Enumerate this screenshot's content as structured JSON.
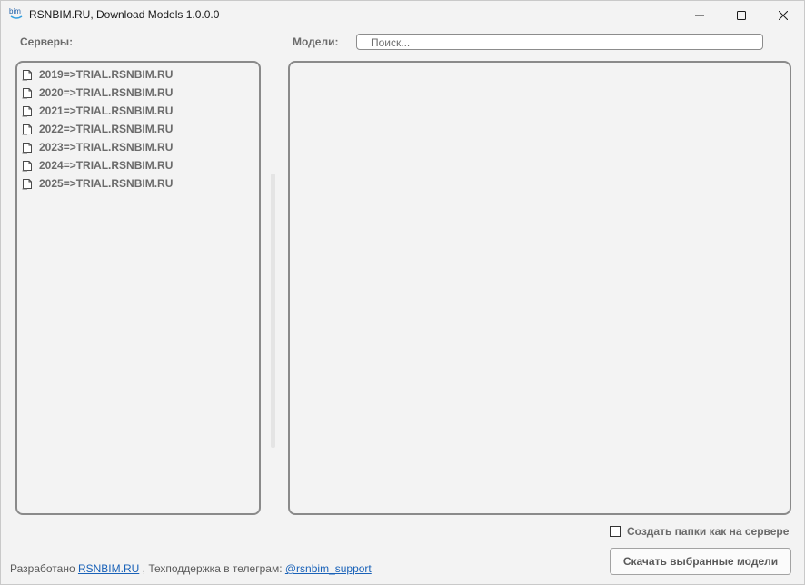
{
  "window": {
    "title": "RSNBIM.RU, Download Models 1.0.0.0",
    "app_icon_text": "bim",
    "controls": [
      "minimize-icon",
      "maximize-icon",
      "close-icon"
    ]
  },
  "servers": {
    "label": "Серверы:",
    "items": [
      {
        "label": "2019=>TRIAL.RSNBIM.RU",
        "icon": "server-file-icon"
      },
      {
        "label": "2020=>TRIAL.RSNBIM.RU",
        "icon": "server-file-icon"
      },
      {
        "label": "2021=>TRIAL.RSNBIM.RU",
        "icon": "server-file-icon"
      },
      {
        "label": "2022=>TRIAL.RSNBIM.RU",
        "icon": "server-file-icon"
      },
      {
        "label": "2023=>TRIAL.RSNBIM.RU",
        "icon": "server-file-icon"
      },
      {
        "label": "2024=>TRIAL.RSNBIM.RU",
        "icon": "server-file-icon"
      },
      {
        "label": "2025=>TRIAL.RSNBIM.RU",
        "icon": "server-file-icon"
      }
    ]
  },
  "models": {
    "label": "Модели:",
    "search_placeholder": "Поиск...",
    "items": []
  },
  "options": {
    "create_folders_label": "Создать папки как на сервере",
    "create_folders_checked": false
  },
  "footer": {
    "prefix": "Разработано",
    "dev_link": "RSNBIM.RU",
    "middle": ", Техподдержка в телеграм:",
    "support_link": "@rsnbim_support"
  },
  "actions": {
    "download_label": "Скачать выбранные модели"
  },
  "colors": {
    "window_bg": "#f3f3f3",
    "border": "#8a8a8a",
    "label_text": "#6b6b6b",
    "link": "#1a62b8"
  }
}
